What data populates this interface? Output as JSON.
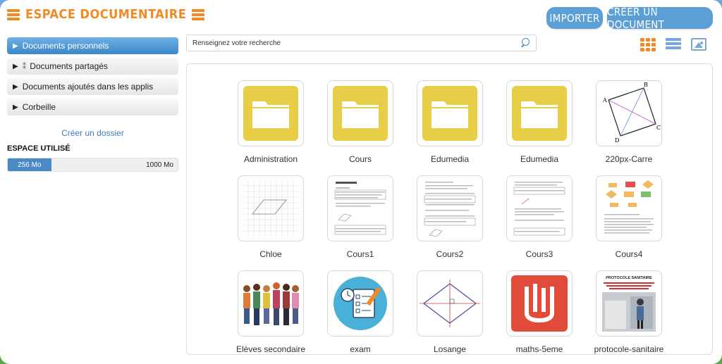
{
  "header": {
    "title": "ESPACE DOCUMENTAIRE",
    "import_label": "IMPORTER",
    "create_label": "CRÉER UN DOCUMENT"
  },
  "sidebar": {
    "items": [
      {
        "label": "Documents personnels"
      },
      {
        "label": "Documents partagés"
      },
      {
        "label": "Documents ajoutés dans les applis"
      },
      {
        "label": "Corbeille"
      }
    ],
    "new_folder": "Créer un dossier",
    "usage_label": "ESPACE UTILISÉ",
    "usage_used": "256 Mo",
    "usage_total": "1000 Mo",
    "usage_ratio": 0.256
  },
  "search": {
    "placeholder": "Renseignez votre recherche"
  },
  "files": [
    {
      "label": "Administration",
      "type": "folder"
    },
    {
      "label": "Cours",
      "type": "folder"
    },
    {
      "label": "Edumedia",
      "type": "folder"
    },
    {
      "label": "Edumedia",
      "type": "folder"
    },
    {
      "label": "220px-Carre",
      "type": "image"
    },
    {
      "label": "Chloe",
      "type": "image"
    },
    {
      "label": "Cours1",
      "type": "document"
    },
    {
      "label": "Cours2",
      "type": "document"
    },
    {
      "label": "Cours3",
      "type": "document"
    },
    {
      "label": "Cours4",
      "type": "document"
    },
    {
      "label": "Elèves secondaire",
      "type": "image"
    },
    {
      "label": "exam",
      "type": "image"
    },
    {
      "label": "Losange",
      "type": "image"
    },
    {
      "label": "maths-5eme",
      "type": "image"
    },
    {
      "label": "protocole-sanitaire",
      "type": "image"
    }
  ],
  "thumb_text": {
    "carre_labels": [
      "A",
      "B",
      "C",
      "D"
    ],
    "protocole_title": "PROTOCOLE SANITAIRE"
  },
  "colors": {
    "accent_orange": "#f08a24",
    "primary_blue": "#5b9fd6",
    "folder_yellow": "#e8ce46"
  }
}
